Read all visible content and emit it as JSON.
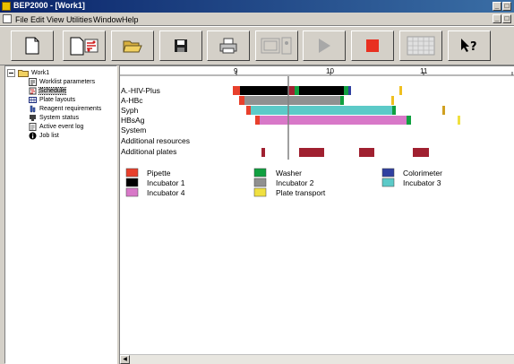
{
  "window": {
    "title": "BEP2000 - [Work1]"
  },
  "menu": {
    "items": [
      "File",
      "Edit",
      "View",
      "Utilities",
      "Window",
      "Help"
    ]
  },
  "toolbar": {
    "buttons": [
      "new-icon",
      "new-worklist-icon",
      "open-icon",
      "save-icon",
      "print-icon",
      "plates-icon",
      "play-icon",
      "stop-icon",
      "grid-icon",
      "help-icon"
    ],
    "worklist_badge": "Work list"
  },
  "tree": {
    "root": "Work1",
    "items": [
      {
        "label": "Worklist parameters",
        "icon": "parameters-icon"
      },
      {
        "label": "Schedule",
        "icon": "schedule-icon",
        "selected": true
      },
      {
        "label": "Plate layouts",
        "icon": "plate-layout-icon"
      },
      {
        "label": "Reagent requirements",
        "icon": "reagent-icon"
      },
      {
        "label": "System status",
        "icon": "system-status-icon"
      },
      {
        "label": "Active event log",
        "icon": "event-log-icon"
      },
      {
        "label": "Job list",
        "icon": "info-icon"
      }
    ]
  },
  "schedule": {
    "time_ticks": [
      "9",
      "10",
      "11"
    ],
    "rows": [
      "A.-HIV-Plus",
      "A-HBc",
      "Syph",
      "HBsAg",
      "System",
      "Additional resources",
      "Additional plates"
    ],
    "legend": [
      {
        "label": "Pipette",
        "color": "#e8402c"
      },
      {
        "label": "Washer",
        "color": "#10a040"
      },
      {
        "label": "Colorimeter",
        "color": "#3040a0"
      },
      {
        "label": "Incubator 1",
        "color": "#000000"
      },
      {
        "label": "Incubator 2",
        "color": "#909090"
      },
      {
        "label": "Incubator 3",
        "color": "#5ccac8"
      },
      {
        "label": "Incubator 4",
        "color": "#d878c8"
      },
      {
        "label": "Plate transport",
        "color": "#f0e040"
      }
    ]
  }
}
